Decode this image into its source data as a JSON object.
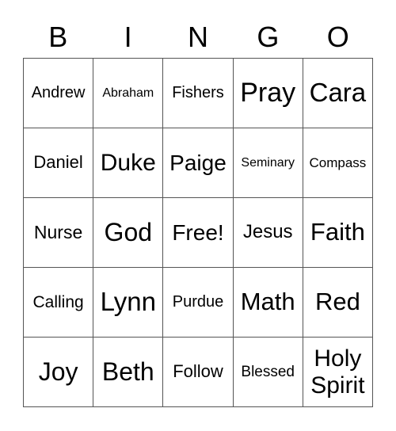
{
  "header": {
    "letters": [
      "B",
      "I",
      "N",
      "G",
      "O"
    ]
  },
  "card": {
    "cells": [
      {
        "text": "Andrew",
        "size": 20
      },
      {
        "text": "Abraham",
        "size": 16
      },
      {
        "text": "Fishers",
        "size": 20
      },
      {
        "text": "Pray",
        "size": 34
      },
      {
        "text": "Cara",
        "size": 33
      },
      {
        "text": "Daniel",
        "size": 22
      },
      {
        "text": "Duke",
        "size": 30
      },
      {
        "text": "Paige",
        "size": 28
      },
      {
        "text": "Seminary",
        "size": 16
      },
      {
        "text": "Compass",
        "size": 17
      },
      {
        "text": "Nurse",
        "size": 23
      },
      {
        "text": "God",
        "size": 32
      },
      {
        "text": "Free!",
        "size": 28
      },
      {
        "text": "Jesus",
        "size": 24
      },
      {
        "text": "Faith",
        "size": 31
      },
      {
        "text": "Calling",
        "size": 21
      },
      {
        "text": "Lynn",
        "size": 33
      },
      {
        "text": "Purdue",
        "size": 20
      },
      {
        "text": "Math",
        "size": 31
      },
      {
        "text": "Red",
        "size": 31
      },
      {
        "text": "Joy",
        "size": 32
      },
      {
        "text": "Beth",
        "size": 32
      },
      {
        "text": "Follow",
        "size": 22
      },
      {
        "text": "Blessed",
        "size": 19
      },
      {
        "text": "Holy\nSpirit",
        "size": 30
      }
    ]
  }
}
